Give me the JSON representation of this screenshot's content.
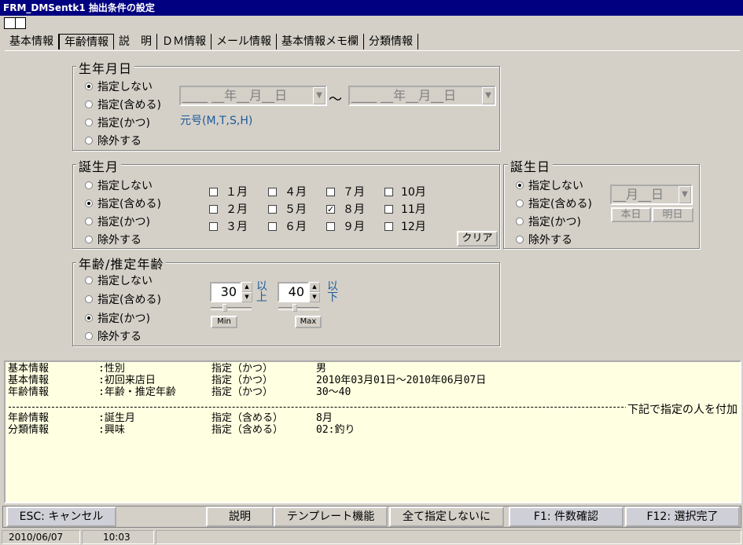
{
  "window": {
    "title": "FRM_DMSentk1 抽出条件の設定"
  },
  "tabs": [
    "基本情報",
    "年齢情報",
    "説　明",
    "ＤＭ情報",
    "メール情報",
    "基本情報メモ欄",
    "分類情報"
  ],
  "birthdate": {
    "legend": "生年月日",
    "options": [
      "指定しない",
      "指定(含める)",
      "指定(かつ)",
      "除外する"
    ],
    "selected": 0,
    "from": "____ __年__月__日",
    "to": "____ __年__月__日",
    "era_hint": "元号(M,T,S,H)"
  },
  "birthmonth": {
    "legend": "誕生月",
    "options": [
      "指定しない",
      "指定(含める)",
      "指定(かつ)",
      "除外する"
    ],
    "selected": 1,
    "months": [
      "１月",
      "２月",
      "３月",
      "４月",
      "５月",
      "６月",
      "７月",
      "８月",
      "９月",
      "10月",
      "11月",
      "12月"
    ],
    "checked": [
      "８月"
    ],
    "clear_label": "クリア"
  },
  "birthday": {
    "legend": "誕生日",
    "options": [
      "指定しない",
      "指定(含める)",
      "指定(かつ)",
      "除外する"
    ],
    "selected": 0,
    "date": "__月__日",
    "today_label": "本日",
    "tomorrow_label": "明日"
  },
  "age": {
    "legend": "年齢/推定年齢",
    "options": [
      "指定しない",
      "指定(含める)",
      "指定(かつ)",
      "除外する"
    ],
    "selected": 2,
    "min_value": "30",
    "max_value": "40",
    "min_suffix_1": "以",
    "min_suffix_2": "上",
    "max_suffix_1": "以",
    "max_suffix_2": "下",
    "min_label": "Min",
    "max_label": "Max"
  },
  "summary": {
    "rows": [
      [
        "基本情報",
        ":性別",
        "指定（かつ）",
        "男"
      ],
      [
        "基本情報",
        ":初回来店日",
        "指定（かつ）",
        "2010年03月01日～2010年06月07日"
      ],
      [
        "年齢情報",
        ":年齢・推定年齢",
        "指定（かつ）",
        "30～40"
      ]
    ],
    "separator_label": "下記で指定の人を付加",
    "rows2": [
      [
        "年齢情報",
        ":誕生月",
        "指定（含める）",
        "8月"
      ],
      [
        "分類情報",
        ":興味",
        "指定（含める）",
        "02:釣り"
      ]
    ]
  },
  "footer": {
    "esc": "ESC: キャンセル",
    "explain": "説明",
    "template": "テンプレート機能",
    "all_none": "全て指定しないに",
    "f1": "F1: 件数確認",
    "f12": "F12: 選択完了"
  },
  "status": {
    "date": "2010/06/07",
    "time": "10:03"
  }
}
